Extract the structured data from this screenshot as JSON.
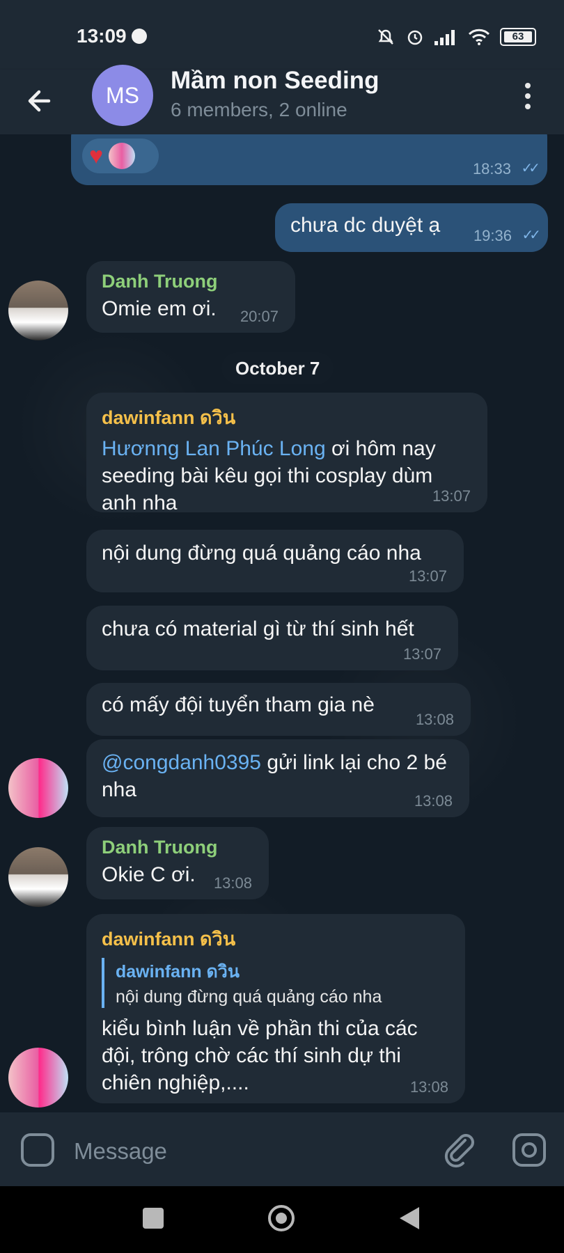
{
  "status_bar": {
    "time": "13:09",
    "battery": "63"
  },
  "header": {
    "avatar_initials": "MS",
    "title": "Mầm non Seeding",
    "subtitle": "6 members, 2 online"
  },
  "chat": {
    "date_separator": "October 7",
    "messages": [
      {
        "time": "18:33"
      },
      {
        "text": "chưa dc duyệt ạ",
        "time": "19:36"
      },
      {
        "sender": "Danh Truong",
        "text": "Omie em ơi.",
        "time": "20:07"
      },
      {
        "sender": "dawinfann ดวิน",
        "mention": "Hươnng Lan Phúc Long",
        "text": " ơi hôm nay seeding bài kêu gọi thi cosplay dùm anh nha",
        "time": "13:07"
      },
      {
        "text": "nội dung đừng quá quảng cáo nha",
        "time": "13:07"
      },
      {
        "text": "chưa có material gì từ thí sinh hết",
        "time": "13:07"
      },
      {
        "text": "có mấy đội tuyển tham gia nè",
        "time": "13:08"
      },
      {
        "mention": "@congdanh0395",
        "text": " gửi link lại cho 2 bé nha",
        "time": "13:08"
      },
      {
        "sender": "Danh Truong",
        "text": "Okie C ơi.",
        "time": "13:08"
      },
      {
        "sender": "dawinfann ดวิน",
        "reply_name": "dawinfann ดวิน",
        "reply_text": "nội dung đừng quá quảng cáo nha",
        "text": "kiểu bình luận về phần thi của các đội, trông chờ các thí sinh dự thi chiên nghiệp,....",
        "time": "13:08"
      }
    ]
  },
  "input": {
    "placeholder": "Message"
  },
  "colors": {
    "accent": "#6ab2f2",
    "danh_name": "#8ecf7a",
    "dawin_name": "#f5c04a",
    "outgoing_bubble": "#2b5278",
    "incoming_bubble": "#202b36"
  }
}
